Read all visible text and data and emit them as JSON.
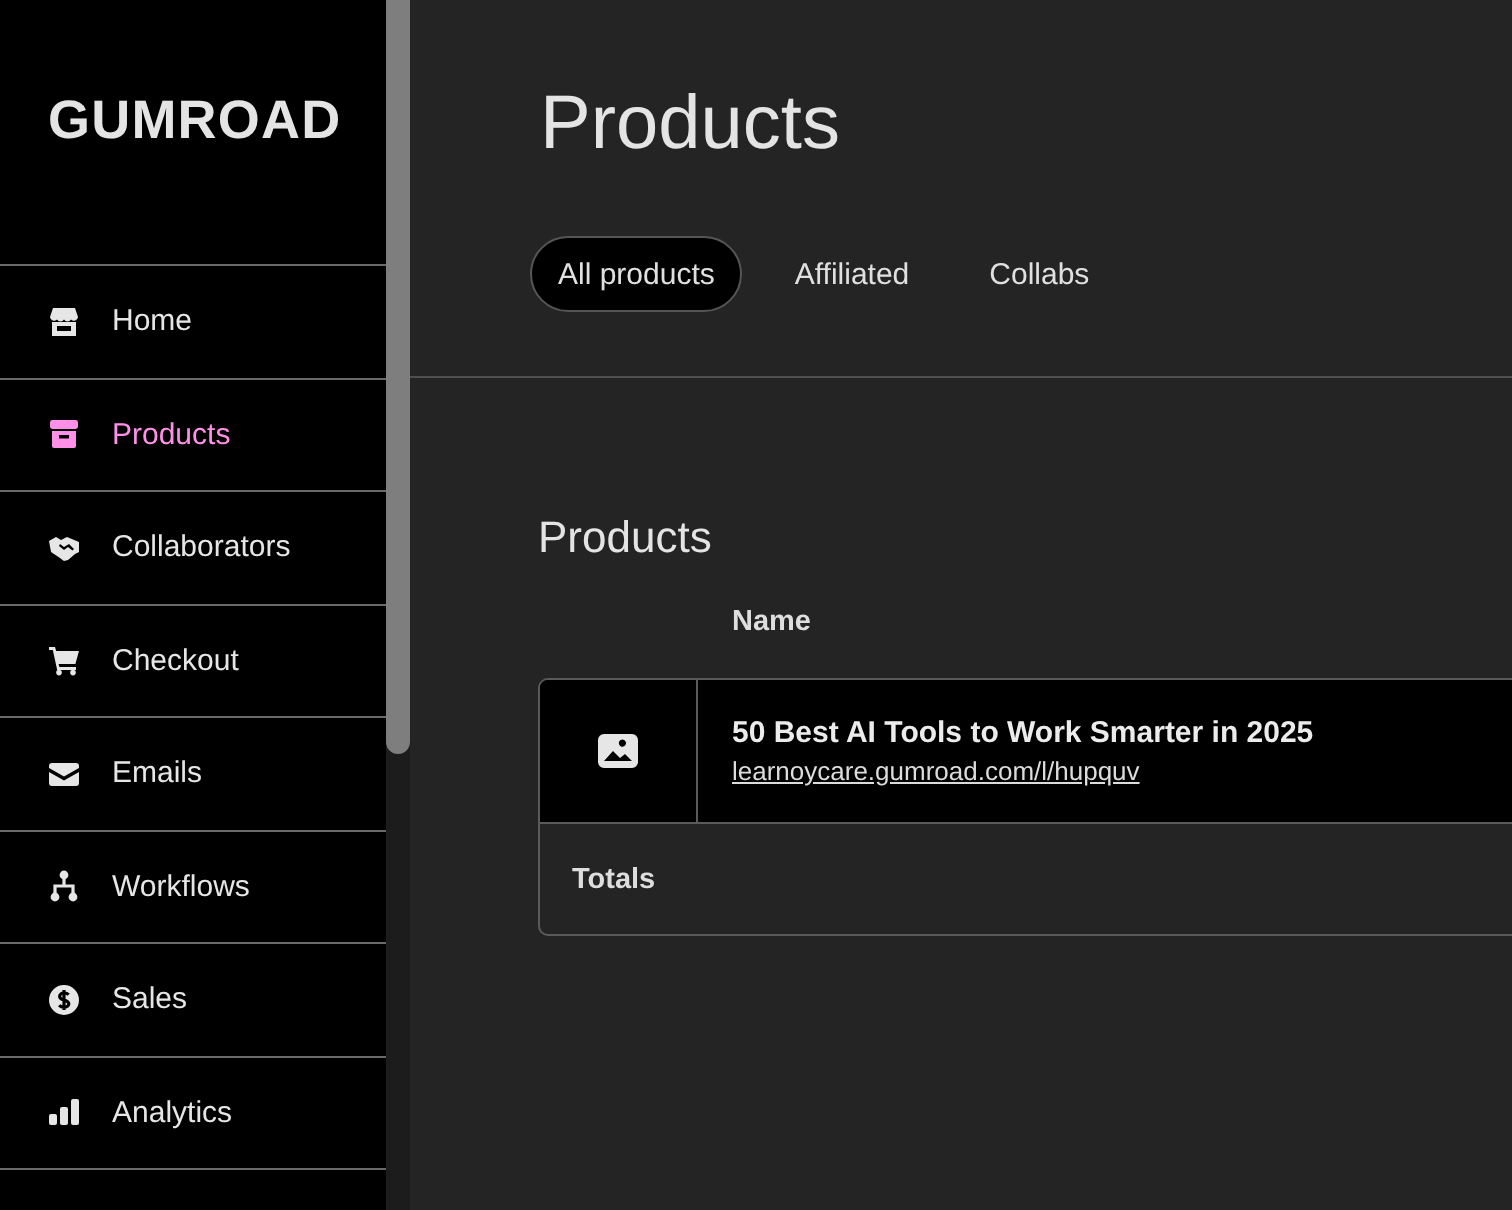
{
  "sidebar": {
    "logo": "GUMROAD",
    "items": [
      {
        "label": "Home",
        "selected": false
      },
      {
        "label": "Products",
        "selected": true
      },
      {
        "label": "Collaborators",
        "selected": false
      },
      {
        "label": "Checkout",
        "selected": false
      },
      {
        "label": "Emails",
        "selected": false
      },
      {
        "label": "Workflows",
        "selected": false
      },
      {
        "label": "Sales",
        "selected": false
      },
      {
        "label": "Analytics",
        "selected": false
      }
    ]
  },
  "header": {
    "title": "Products",
    "tabs": [
      {
        "label": "All products",
        "selected": true
      },
      {
        "label": "Affiliated",
        "selected": false
      },
      {
        "label": "Collabs",
        "selected": false
      }
    ]
  },
  "section": {
    "title": "Products",
    "table": {
      "columns": [
        "Name"
      ],
      "rows": [
        {
          "name": "50 Best AI Tools to Work Smarter in 2025",
          "url": "learnoycare.gumroad.com/l/hupquv"
        }
      ],
      "totals_label": "Totals"
    }
  }
}
